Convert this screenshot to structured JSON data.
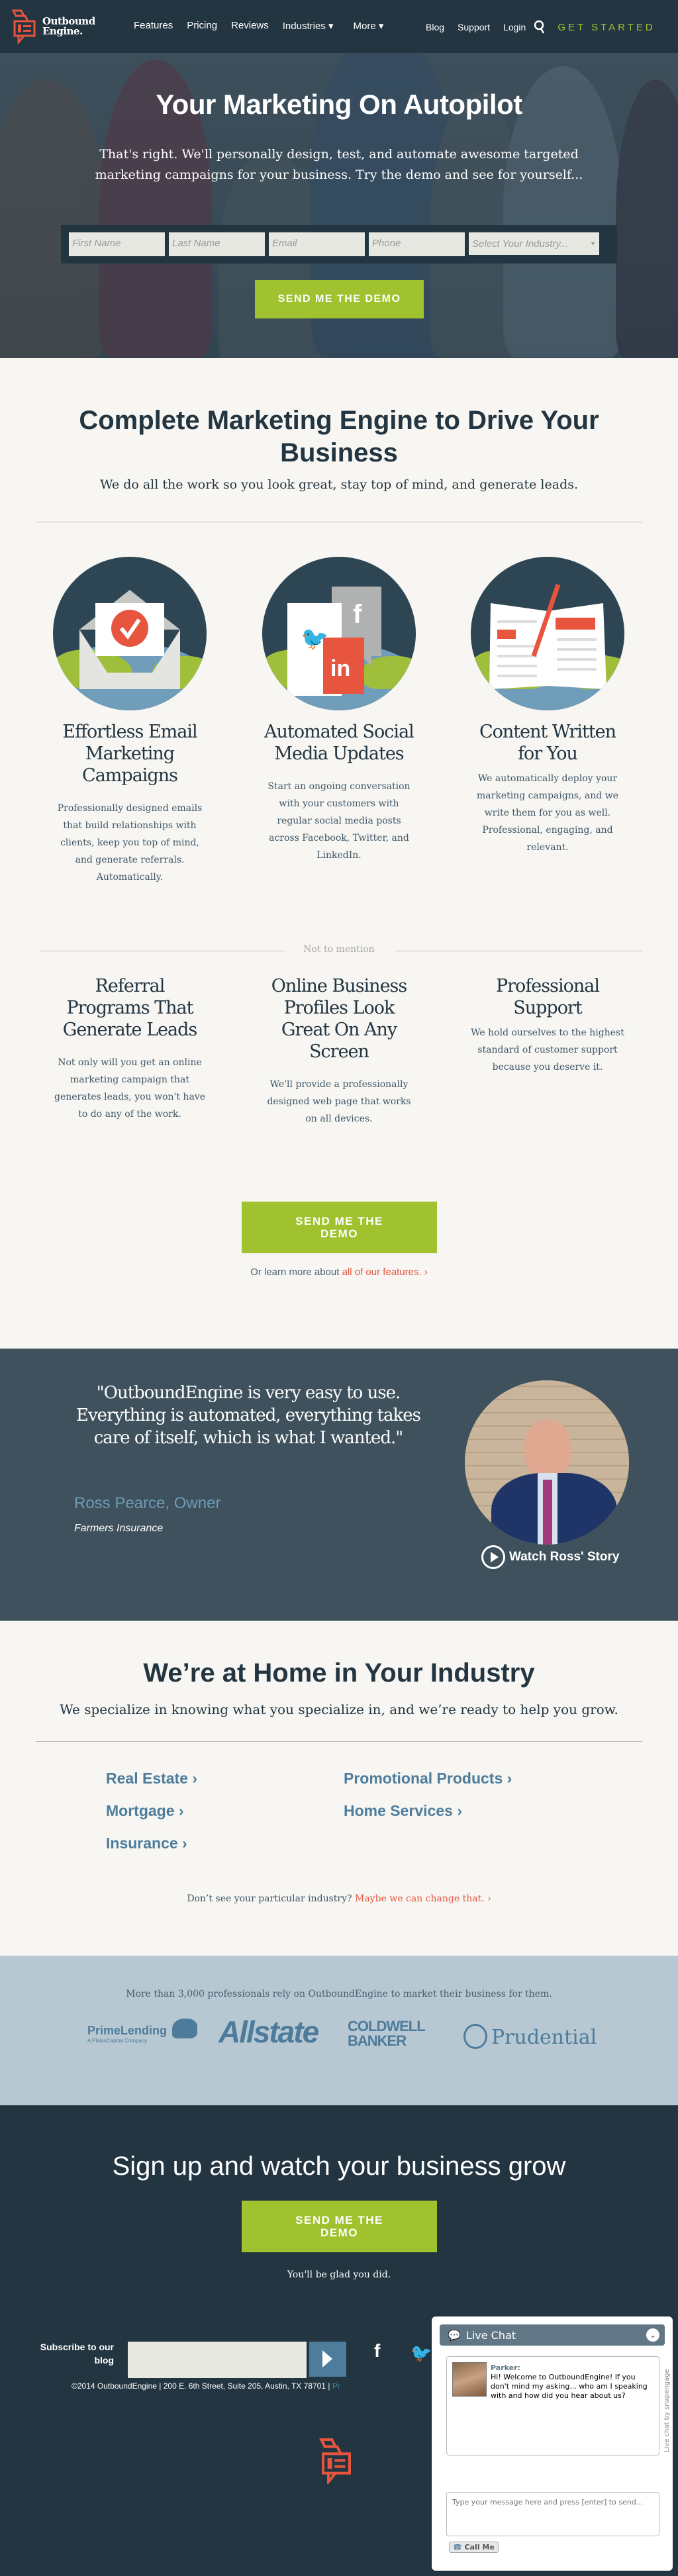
{
  "nav": {
    "logo_line1": "Outbound",
    "logo_line2": "Engine.",
    "links": [
      "Features",
      "Pricing",
      "Reviews",
      "Industries ▾",
      "More ▾"
    ],
    "right_links": [
      "Blog",
      "Support",
      "Login"
    ],
    "get_started": "GET STARTED"
  },
  "hero": {
    "title": "Your Marketing On Autopilot",
    "subtitle": "That's right. We'll personally design, test, and automate awesome targeted marketing campaigns for your business. Try the demo and see for yourself...",
    "fields": {
      "first_name": "First Name",
      "last_name": "Last Name",
      "email": "Email",
      "phone": "Phone",
      "industry": "Select Your Industry..."
    },
    "button": "SEND ME THE DEMO"
  },
  "features": {
    "title": "Complete Marketing Engine to Drive Your Business",
    "subtitle": "We do all the work so you look great, stay top of mind, and generate leads.",
    "main": [
      {
        "icon": "email-envelope-check-icon",
        "title": "Effortless Email Marketing Campaigns",
        "text": "Professionally designed emails that build relationships with clients, keep you top of mind, and generate referrals. Automatically."
      },
      {
        "icon": "social-media-icon",
        "title": "Automated Social Media Updates",
        "text": "Start an ongoing conversation with your customers with regular social media posts across Facebook, Twitter, and LinkedIn."
      },
      {
        "icon": "content-book-pen-icon",
        "title": "Content Written for You",
        "text": "We automatically deploy your marketing campaigns, and we write them for you as well. Professional, engaging, and relevant."
      }
    ],
    "divider_label": "Not to mention",
    "extra": [
      {
        "title": "Referral Programs That Generate Leads",
        "text": "Not only will you get an online marketing campaign that generates leads, you won't have to do any of the work."
      },
      {
        "title": "Online Business Profiles Look Great On Any Screen",
        "text": "We'll provide a professionally designed web page that works on all devices."
      },
      {
        "title": "Professional Support",
        "text": "We hold ourselves to the highest standard of customer support because you deserve it."
      }
    ],
    "button": "SEND ME THE DEMO",
    "learn_prefix": "Or learn more about ",
    "learn_link": "all of our features. ›"
  },
  "testimonial": {
    "quote": "\"OutboundEngine is very easy to use. Everything is automated, everything takes care of itself, which is what I wanted.\"",
    "author": "Ross Pearce, Owner",
    "company": "Farmers Insurance",
    "watch": "Watch Ross' Story"
  },
  "industry": {
    "title": "We’re at Home in Your Industry",
    "subtitle": "We specialize in knowing what you specialize in, and we’re ready to help you grow.",
    "links_left": [
      "Real Estate ›",
      "Mortgage ›",
      "Insurance ›"
    ],
    "links_right": [
      "Promotional Products ›",
      "Home Services ›"
    ],
    "dont_prefix": "Don’t see your particular industry? ",
    "dont_link": "Maybe we can change that. ›"
  },
  "logos": {
    "note": "More than 3,000 professionals rely on OutboundEngine to market their business for them.",
    "brands": [
      "PrimeLending",
      "A PlainsCapital Company",
      "Allstate",
      "COLDWELL",
      "BANKER",
      "Prudential"
    ]
  },
  "cta": {
    "title": "Sign up and watch your business grow",
    "button": "SEND ME THE DEMO",
    "glad": "You'll be glad you did.",
    "subscribe": "Subscribe to our blog",
    "copyright": "©2014 OutboundEngine  |  200 E. 6th Street, Suite 205, Austin, TX 78701  |",
    "privacy": "Pr"
  },
  "chat": {
    "header": "Live Chat",
    "agent": "Parker:",
    "message": "Hi! Welcome to OutboundEngine! If you don't mind my asking... who am I speaking with and how did you hear about us?",
    "input_placeholder": "Type your message here and press [enter] to send...",
    "powered": "Live chat by snapengage",
    "call_me": "Call Me"
  },
  "colors": {
    "navy": "#223541",
    "green": "#a0c22f",
    "accent_red": "#e8553e",
    "link_blue": "#4e7d9c",
    "bg": "#f7f6f2"
  }
}
